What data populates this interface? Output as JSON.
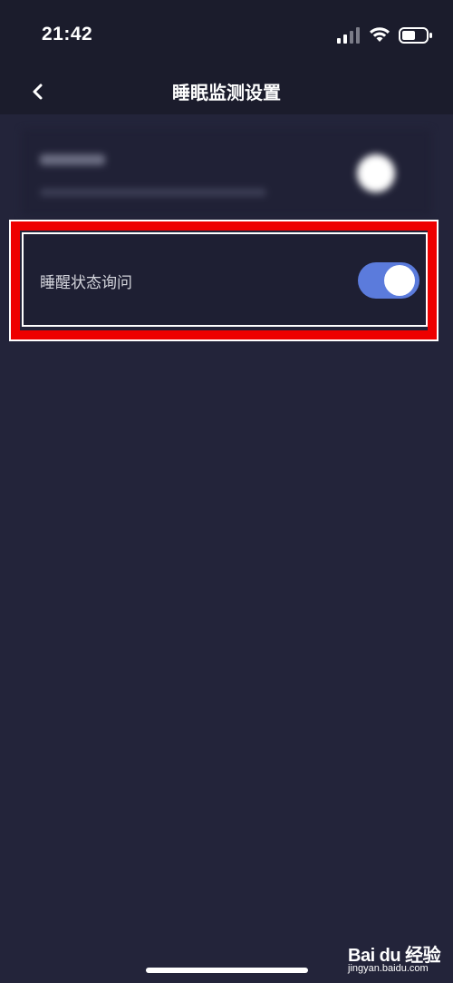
{
  "status_bar": {
    "time": "21:42",
    "icons": [
      "signal-icon",
      "wifi-icon",
      "battery-icon"
    ]
  },
  "nav": {
    "back_icon": "chevron-left-icon",
    "title": "睡眠监测设置"
  },
  "settings": [
    {
      "label": "睡醒状态询问",
      "toggle_on": true
    }
  ],
  "watermark": {
    "logo": "Bai du 经验",
    "url": "jingyan.baidu.com"
  },
  "colors": {
    "background": "#23243a",
    "header": "#1b1c2c",
    "toggle_on": "#5b7bdc",
    "highlight": "#ee0000"
  }
}
